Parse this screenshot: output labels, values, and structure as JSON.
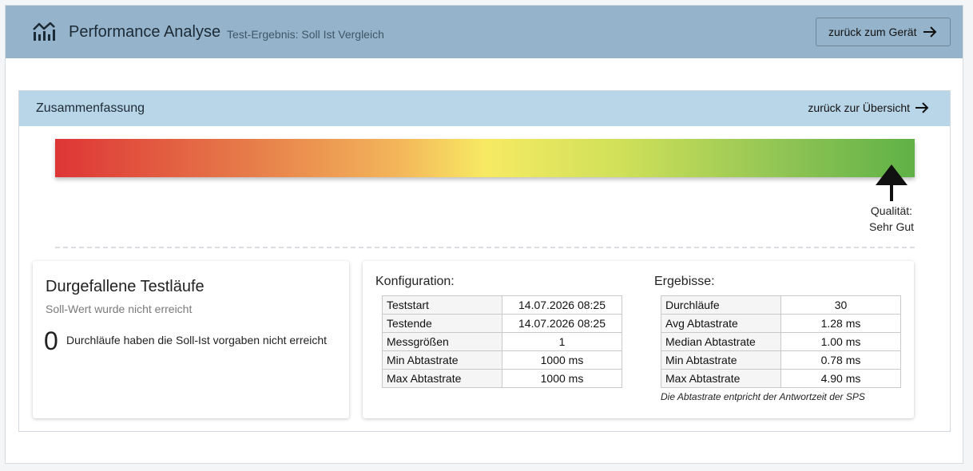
{
  "header": {
    "icon": "bar-chart-icon",
    "title": "Performance Analyse",
    "subtitle": "Test-Ergebnis: Soll Ist Vergleich",
    "back_button_label": "zurück zum Gerät"
  },
  "summary": {
    "title": "Zusammenfassung",
    "back_link_label": "zurück zur Übersicht",
    "quality": {
      "label": "Qualität:",
      "value": "Sehr Gut",
      "level": 0.97,
      "gradient_colors": [
        "#de3536",
        "#f7ea63",
        "#5fb146"
      ]
    }
  },
  "failed_runs": {
    "title": "Durgefallene Testläufe",
    "subtitle": "Soll-Wert wurde nicht erreicht",
    "count": "0",
    "text": "Durchläufe haben die Soll-Ist vorgaben nicht erreicht"
  },
  "configuration": {
    "title": "Konfiguration:",
    "rows": [
      {
        "key": "Teststart",
        "value": "14.07.2026 08:25"
      },
      {
        "key": "Testende",
        "value": "14.07.2026 08:25"
      },
      {
        "key": "Messgrößen",
        "value": "1"
      },
      {
        "key": "Min Abtastrate",
        "value": "1000 ms"
      },
      {
        "key": "Max Abtastrate",
        "value": "1000 ms"
      }
    ]
  },
  "results": {
    "title": "Ergebisse:",
    "rows": [
      {
        "key": "Durchläufe",
        "value": "30"
      },
      {
        "key": "Avg Abtastrate",
        "value": "1.28 ms"
      },
      {
        "key": "Median Abtastrate",
        "value": "1.00 ms"
      },
      {
        "key": "Min Abtastrate",
        "value": "0.78 ms"
      },
      {
        "key": "Max Abtastrate",
        "value": "4.90 ms"
      }
    ],
    "note": "Die Abtastrate entpricht der Antwortzeit der SPS"
  }
}
